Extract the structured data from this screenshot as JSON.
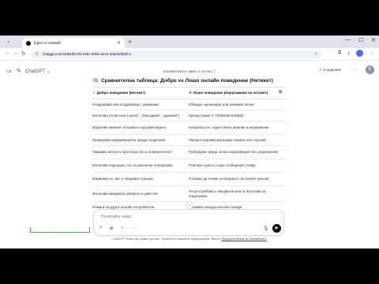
{
  "browser": {
    "tab_title": "Едно и сличай",
    "url": "chatgpt.com/c/6815b7d3-e5bc-800b-aec3-3da030f80fc1",
    "new_tab_symbol": "+",
    "menu_symbol": "⌄"
  },
  "app": {
    "model_label": "ChatGPT ⌄",
    "center_note": "Запаметената памет е пълна ⓘ",
    "share_label": "⇪ Споделяне",
    "more_symbol": "···",
    "avatar_letter": "K"
  },
  "content": {
    "heading_icon": "🧠",
    "heading": "Сравнителна таблица: Добро vs Лошо онлайн поведение (Нетикет)",
    "col1_header": "Добро поведение (Нетикет)",
    "col2_header": "Лошо поведение (Нарушаване на нетикет)",
    "rows": [
      {
        "good": "Поздравява или поздравява с уважение",
        "bad": "Обижда, иронизира или унижава лично"
      },
      {
        "good": "Използва учтив език („моля“, „благодаря“, „здравей“)",
        "bad": "Крещи (пише С ГОЛЕМИ БУКВИ)"
      },
      {
        "good": "Изразява мнение спокойно и аргументирано",
        "bad": "Натрапва се с единствено мнение и неуважение"
      },
      {
        "good": "Проверява информацията преди споделяне",
        "bad": "Разпространява фалшиви новини или слухове"
      },
      {
        "good": "Уважава личното пространство и поверителност",
        "bad": "Публикува чужда лична информация без разрешение"
      },
      {
        "good": "Използва подходящ тон за различни платформи",
        "bad": "Повтаря едни и същи съобщения (спам)"
      },
      {
        "good": "Извинява се, ако е направил грешка",
        "bad": "Отказва да поеме отговорност за своите грешки"
      },
      {
        "good": "Използва емоджита умерено и уместно",
        "bad": "Злоупотребява с емоджита или ги използва за подигравки"
      },
      {
        "good": "Помага на други онлайн потребители",
        "bad": "Унижава новодошли или гъводе"
      }
    ]
  },
  "composer": {
    "placeholder": "Попитайте нещо",
    "tool_plus": "+",
    "tool_globe": "⊕",
    "tool_bulb": "♀",
    "tool_more": "···",
    "mic_symbol": "🎙",
    "voice_symbol": "▶"
  },
  "footer": {
    "text": "ChatGPT може да прави грешки. Проверете важната информация. Вижте",
    "link": "Предпочитания за бисквитките"
  }
}
